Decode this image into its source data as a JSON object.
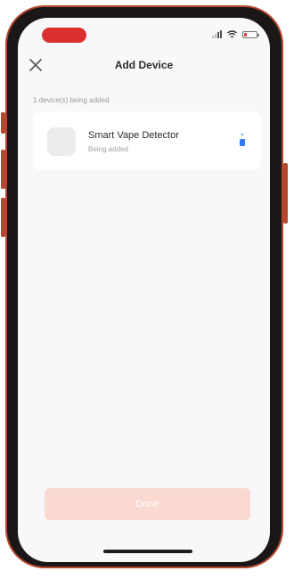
{
  "header": {
    "title": "Add Device"
  },
  "summary": {
    "count_text": "1 device(s) being added"
  },
  "device": {
    "name": "Smart Vape Detector",
    "status": "Being added"
  },
  "footer": {
    "done_label": "Done"
  },
  "colors": {
    "accent": "#dc2f2f",
    "button_disabled": "#f9d9d1",
    "spinner": "#2f7cf6"
  }
}
